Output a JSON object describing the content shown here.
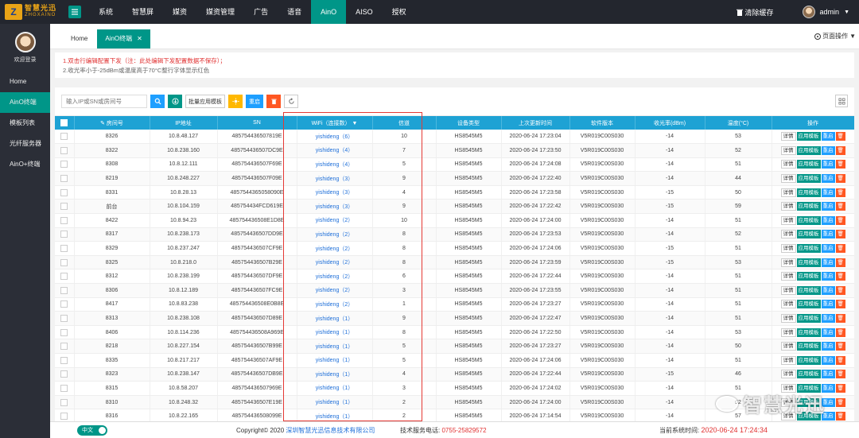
{
  "logo": {
    "cn": "智慧光迅",
    "en": "ZHGXAINO",
    "mark": "Z"
  },
  "topnav": [
    "系统",
    "智慧屏",
    "媒资",
    "媒资管理",
    "广告",
    "语音",
    "AinO",
    "AISO",
    "授权"
  ],
  "topnav_active": 6,
  "topright": {
    "clear_cache": "清除缓存",
    "admin": "admin"
  },
  "sidebar": {
    "welcome": "欢迎登录",
    "items": [
      "Home",
      "AinO终端",
      "模板列表",
      "光纤服务器",
      "AinO+终端"
    ],
    "active": 1
  },
  "tabs": [
    {
      "label": "Home"
    },
    {
      "label": "AinO终端"
    }
  ],
  "page_ops": "页面操作",
  "notice": {
    "line1": "1.双击行编辑配置下发（注：此处编辑下发配置数据不保存）；",
    "line2": "2.收光率小于-25dBm或温度高于70°C整行字体显示红色"
  },
  "toolbar": {
    "search_placeholder": "输入IP或SN或房间号",
    "batch_apply": "批量应用模板",
    "restart": "重启"
  },
  "table": {
    "headers": [
      "房间号",
      "IP地址",
      "SN",
      "WiFi（连接数）",
      "信道",
      "设备类型",
      "上次更新时间",
      "软件版本",
      "收光率(dBm)",
      "温度(°C)",
      "操作"
    ],
    "ops": {
      "detail": "详情",
      "apply": "应用模板",
      "restart": "重启"
    },
    "rows": [
      [
        "8326",
        "10.8.48.127",
        "485754436507819E",
        "yishideng（6）",
        "10",
        "HS8545M5",
        "2020-06-24 17:23:04",
        "V5R019C00S030",
        "-14",
        "53"
      ],
      [
        "8322",
        "10.8.238.160",
        "485754436507DC9E",
        "yishideng（4）",
        "7",
        "HS8545M5",
        "2020-06-24 17:23:50",
        "V5R019C00S030",
        "-14",
        "52"
      ],
      [
        "8308",
        "10.8.12.111",
        "485754436507F69E",
        "yishideng（4）",
        "5",
        "HS8545M5",
        "2020-06-24 17:24:08",
        "V5R019C00S030",
        "-14",
        "51"
      ],
      [
        "8219",
        "10.8.248.227",
        "485754436507F09E",
        "yishideng（3）",
        "9",
        "HS8545M5",
        "2020-06-24 17:22:40",
        "V5R019C00S030",
        "-14",
        "44"
      ],
      [
        "8331",
        "10.8.28.13",
        "4857544365058090E",
        "yishideng（3）",
        "4",
        "HS8545M5",
        "2020-06-24 17:23:58",
        "V5R019C00S030",
        "-15",
        "50"
      ],
      [
        "前台",
        "10.8.104.159",
        "485754434FCD619E",
        "yishideng（3）",
        "9",
        "HS8545M5",
        "2020-06-24 17:22:42",
        "V5R019C00S030",
        "-15",
        "59"
      ],
      [
        "8422",
        "10.8.94.23",
        "485754436508E1D8E",
        "yishideng（2）",
        "10",
        "HS8545M5",
        "2020-06-24 17:24:00",
        "V5R019C00S030",
        "-14",
        "51"
      ],
      [
        "8317",
        "10.8.238.173",
        "485754436507DD9E",
        "yishideng（2）",
        "8",
        "HS8545M5",
        "2020-06-24 17:23:53",
        "V5R019C00S030",
        "-14",
        "52"
      ],
      [
        "8329",
        "10.8.237.247",
        "485754436507CF9E",
        "yishideng（2）",
        "8",
        "HS8545M5",
        "2020-06-24 17:24:06",
        "V5R019C00S030",
        "-15",
        "51"
      ],
      [
        "8325",
        "10.8.218.0",
        "485754436507B29E",
        "yishideng（2）",
        "8",
        "HS8545M5",
        "2020-06-24 17:23:59",
        "V5R019C00S030",
        "-15",
        "53"
      ],
      [
        "8312",
        "10.8.238.199",
        "485754436507DF9E",
        "yishideng（2）",
        "6",
        "HS8545M5",
        "2020-06-24 17:22:44",
        "V5R019C00S030",
        "-14",
        "51"
      ],
      [
        "8306",
        "10.8.12.189",
        "485754436507FC9E",
        "yishideng（2）",
        "3",
        "HS8545M5",
        "2020-06-24 17:23:55",
        "V5R019C00S030",
        "-14",
        "51"
      ],
      [
        "8417",
        "10.8.83.238",
        "485754436508E0B8E",
        "yishideng（2）",
        "1",
        "HS8545M5",
        "2020-06-24 17:23:27",
        "V5R019C00S030",
        "-14",
        "51"
      ],
      [
        "8313",
        "10.8.238.108",
        "485754436507D89E",
        "yishideng（1）",
        "9",
        "HS8545M5",
        "2020-06-24 17:22:47",
        "V5R019C00S030",
        "-14",
        "51"
      ],
      [
        "8406",
        "10.8.114.236",
        "485754436508A969E",
        "yishideng（1）",
        "8",
        "HS8545M5",
        "2020-06-24 17:22:50",
        "V5R019C00S030",
        "-14",
        "53"
      ],
      [
        "8218",
        "10.8.227.154",
        "485754436507B99E",
        "yishideng（1）",
        "5",
        "HS8545M5",
        "2020-06-24 17:23:27",
        "V5R019C00S030",
        "-14",
        "50"
      ],
      [
        "8335",
        "10.8.217.217",
        "485754436507AF9E",
        "yishideng（1）",
        "5",
        "HS8545M5",
        "2020-06-24 17:24:06",
        "V5R019C00S030",
        "-14",
        "51"
      ],
      [
        "8323",
        "10.8.238.147",
        "485754436507DB9E",
        "yishideng（1）",
        "4",
        "HS8545M5",
        "2020-06-24 17:22:44",
        "V5R019C00S030",
        "-15",
        "46"
      ],
      [
        "8315",
        "10.8.58.207",
        "485754436507969E",
        "yishideng（1）",
        "3",
        "HS8545M5",
        "2020-06-24 17:24:02",
        "V5R019C00S030",
        "-14",
        "51"
      ],
      [
        "8310",
        "10.8.248.32",
        "485754436507E19E",
        "yishideng（1）",
        "2",
        "HS8545M5",
        "2020-06-24 17:24:00",
        "V5R019C00S030",
        "-14",
        "52"
      ],
      [
        "8316",
        "10.8.22.165",
        "485754436508099E",
        "yishideng（1）",
        "2",
        "HS8545M5",
        "2020-06-24 17:14:54",
        "V5R019C00S030",
        "-14",
        "57"
      ]
    ]
  },
  "footer": {
    "lang": "中文",
    "copyright_prefix": "Copyright© 2020",
    "company": "深圳智慧光迅信息技术有限公司",
    "phone_label": "技术服务电话:",
    "phone": "0755-25829572",
    "systime_label": "当前系统时间:",
    "systime": "2020-06-24 17:24:34"
  },
  "watermark": "智慧光迅",
  "colors": {
    "accent": "#009688",
    "header": "#1ea2d4",
    "topbar": "#23262e",
    "sidebar": "#2b2e37",
    "highlight": "#e53935"
  }
}
